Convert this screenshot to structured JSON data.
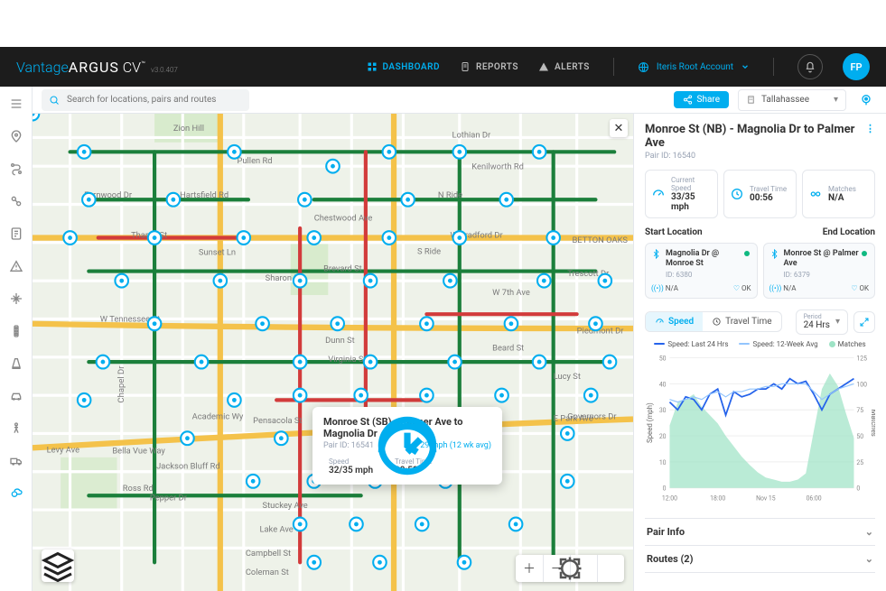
{
  "brand": {
    "thin": "Vantage",
    "bold": "ARGUS",
    "cv": "CV",
    "tm": "™",
    "ver": "v3.0.407"
  },
  "nav": {
    "dashboard": "DASHBOARD",
    "reports": "REPORTS",
    "alerts": "ALERTS"
  },
  "account": {
    "label": "Iteris Root Account",
    "avatar": "FP"
  },
  "search": {
    "placeholder": "Search for locations, pairs and routes"
  },
  "share": {
    "label": "Share"
  },
  "region": {
    "label": "Tallahassee"
  },
  "tooltip": {
    "title": "Monroe St (SB) - Palmer Ave to Magnolia Dr",
    "pair_id": "Pair ID: 16541",
    "avg": "29 mph (12 wk avg)",
    "speed_label": "Speed",
    "speed_val": "32/35 mph",
    "tt_label": "Travel Time",
    "tt_val": "00:58"
  },
  "panel": {
    "title": "Monroe St (NB) - Magnolia Dr to Palmer Ave",
    "pair_id": "Pair ID: 16540",
    "kpis": {
      "speed": {
        "label": "Current Speed",
        "val": "33/35 mph"
      },
      "tt": {
        "label": "Travel Time",
        "val": "00:56"
      },
      "matches": {
        "label": "Matches",
        "val": "N/A"
      }
    },
    "start": {
      "heading": "Start Location",
      "name": "Magnolia Dr @ Monroe St",
      "id": "ID: 6380",
      "sig": "N/A",
      "dev": "OK"
    },
    "end": {
      "heading": "End Location",
      "name": "Monroe St @ Palmer Ave",
      "id": "ID: 6379",
      "sig": "N/A",
      "dev": "OK"
    },
    "tabs": {
      "speed": "Speed",
      "travel": "Travel Time"
    },
    "period": {
      "label": "Period",
      "val": "24 Hrs"
    },
    "legend": {
      "a": "Speed: Last 24 Hrs",
      "b": "Speed: 12-Week Avg",
      "c": "Matches"
    },
    "yaxis": "Speed (mph)",
    "yaxis2": "Matches",
    "xticks": [
      "12:00",
      "18:00",
      "Nov 15",
      "06:00"
    ],
    "pair_info": "Pair Info",
    "routes": "Routes (2)"
  },
  "colors": {
    "blue": "#00AEEF",
    "green": "#10b981",
    "red": "#ef4444",
    "area": "#9de3c5",
    "line1": "#2563eb",
    "line2": "#93c5fd"
  },
  "chart_data": {
    "type": "line",
    "title": "Speed",
    "xlabel": "",
    "ylabel": "Speed (mph)",
    "ylabel2": "Matches",
    "ylim": [
      0,
      50
    ],
    "ylim2": [
      0,
      125
    ],
    "x_hours": [
      12,
      13,
      14,
      15,
      16,
      17,
      18,
      19,
      20,
      21,
      22,
      23,
      0,
      1,
      2,
      3,
      4,
      5,
      6,
      7,
      8,
      9,
      10,
      11
    ],
    "series": [
      {
        "name": "Speed: Last 24 Hrs",
        "color": "#2563eb",
        "values": [
          33,
          30,
          35,
          34,
          30,
          36,
          38,
          28,
          37,
          35,
          36,
          38,
          38,
          40,
          38,
          42,
          40,
          41,
          36,
          30,
          36,
          38,
          40,
          42
        ]
      },
      {
        "name": "Speed: 12-Week Avg",
        "color": "#93c5fd",
        "values": [
          34,
          33,
          34,
          35,
          34,
          36,
          37,
          35,
          37,
          37,
          38,
          38,
          39,
          39,
          40,
          40,
          40,
          40,
          37,
          34,
          36,
          38,
          39,
          40
        ]
      },
      {
        "name": "Matches",
        "type": "area",
        "axis": "right",
        "color": "#9de3c5",
        "values": [
          60,
          82,
          85,
          90,
          78,
          70,
          62,
          50,
          40,
          30,
          22,
          15,
          10,
          8,
          6,
          6,
          8,
          14,
          55,
          95,
          110,
          98,
          72,
          48
        ]
      }
    ],
    "x_tick_labels": [
      "12:00",
      "18:00",
      "Nov 15",
      "06:00"
    ]
  }
}
